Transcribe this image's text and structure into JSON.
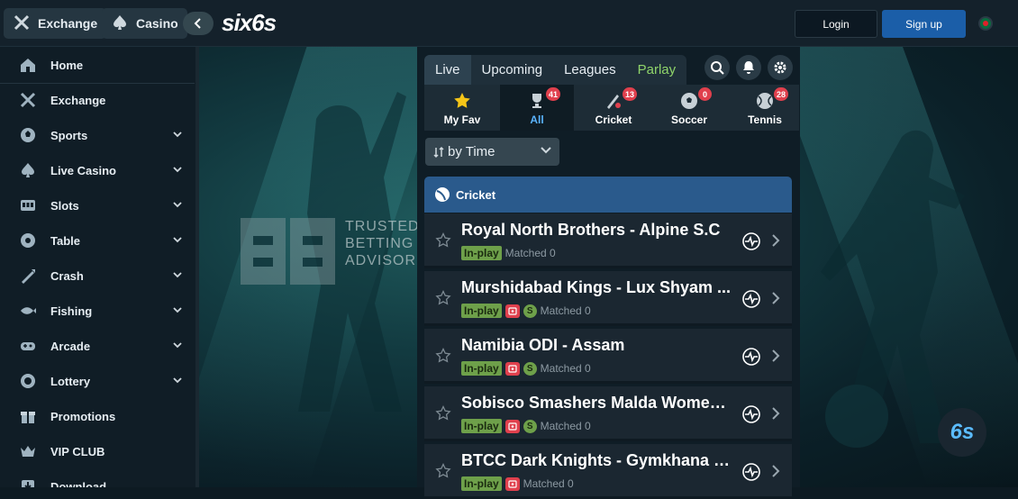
{
  "topbar": {
    "exchange_label": "Exchange",
    "casino_label": "Casino",
    "logo_text": "six6s",
    "login_label": "Login",
    "signup_label": "Sign up"
  },
  "sidebar": {
    "items": [
      {
        "label": "Home",
        "icon": "home-icon",
        "expandable": false
      },
      {
        "label": "Exchange",
        "icon": "exchange-icon",
        "expandable": false
      },
      {
        "label": "Sports",
        "icon": "sports-icon",
        "expandable": true
      },
      {
        "label": "Live Casino",
        "icon": "live-casino-icon",
        "expandable": true
      },
      {
        "label": "Slots",
        "icon": "slots-icon",
        "expandable": true
      },
      {
        "label": "Table",
        "icon": "table-icon",
        "expandable": true
      },
      {
        "label": "Crash",
        "icon": "crash-icon",
        "expandable": true
      },
      {
        "label": "Fishing",
        "icon": "fishing-icon",
        "expandable": true
      },
      {
        "label": "Arcade",
        "icon": "arcade-icon",
        "expandable": true
      },
      {
        "label": "Lottery",
        "icon": "lottery-icon",
        "expandable": true
      },
      {
        "label": "Promotions",
        "icon": "promotions-icon",
        "expandable": false
      },
      {
        "label": "VIP CLUB",
        "icon": "vip-icon",
        "expandable": false
      },
      {
        "label": "Download",
        "icon": "download-icon",
        "expandable": false
      }
    ]
  },
  "watermark": {
    "line1": "TRUSTED",
    "line2": "BETTING",
    "line3": "ADVISOR"
  },
  "badge_text": "6s",
  "tabs": {
    "live": "Live",
    "upcoming": "Upcoming",
    "leagues": "Leagues",
    "parlay": "Parlay"
  },
  "sports": [
    {
      "label": "My Fav",
      "icon": "star-icon",
      "count": null
    },
    {
      "label": "All",
      "icon": "trophy-icon",
      "count": "41"
    },
    {
      "label": "Cricket",
      "icon": "cricket-icon",
      "count": "13"
    },
    {
      "label": "Soccer",
      "icon": "soccer-icon",
      "count": "0"
    },
    {
      "label": "Tennis",
      "icon": "tennis-icon",
      "count": "28"
    }
  ],
  "sort": {
    "label": "by Time"
  },
  "category": {
    "label": "Cricket"
  },
  "matches": [
    {
      "title": "Royal North Brothers - Alpine S.C",
      "status": "In-play",
      "matched": "Matched 0",
      "tv": false,
      "score": false
    },
    {
      "title": "Murshidabad Kings - Lux Shyam ...",
      "status": "In-play",
      "matched": "Matched 0",
      "tv": true,
      "score": true,
      "score_letter": "S"
    },
    {
      "title": "Namibia ODI - Assam",
      "status": "In-play",
      "matched": "Matched 0",
      "tv": true,
      "score": true,
      "score_letter": "S"
    },
    {
      "title": "Sobisco Smashers Malda Women ...",
      "status": "In-play",
      "matched": "Matched 0",
      "tv": true,
      "score": true,
      "score_letter": "S"
    },
    {
      "title": "BTCC Dark Knights - Gymkhana G...",
      "status": "In-play",
      "matched": "Matched 0",
      "tv": true,
      "score": false
    }
  ],
  "colors": {
    "accent_blue": "#1b5ea8",
    "category_header": "#2a5a8c",
    "inplay_green": "#6ea04a",
    "parlay_green": "#8fd46a",
    "badge_red": "#e0404d"
  }
}
